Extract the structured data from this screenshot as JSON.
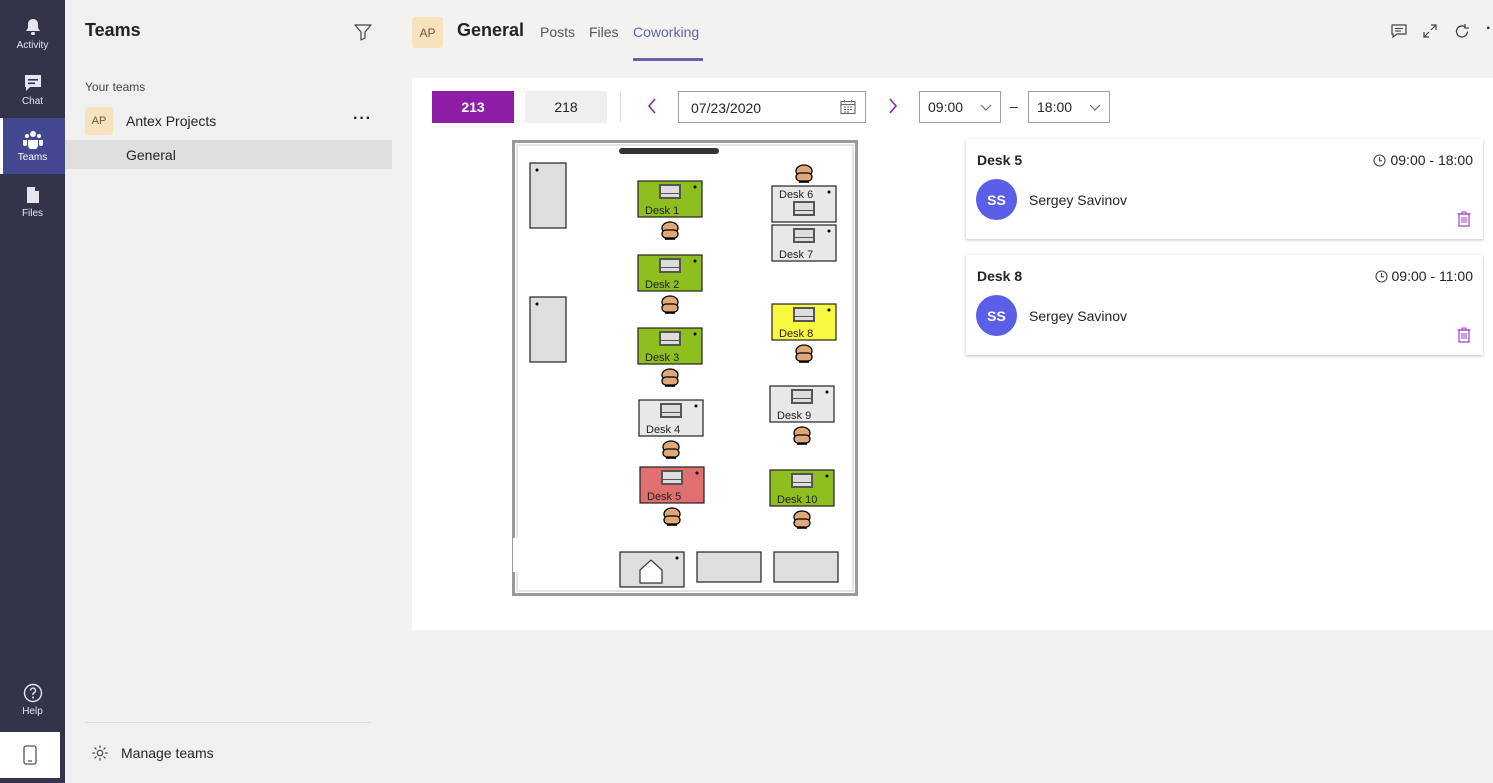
{
  "rail": {
    "items": [
      {
        "label": "Activity",
        "icon": "bell-icon"
      },
      {
        "label": "Chat",
        "icon": "chat-icon"
      },
      {
        "label": "Teams",
        "icon": "teams-icon"
      },
      {
        "label": "Files",
        "icon": "file-icon"
      }
    ],
    "help_label": "Help"
  },
  "sidebar": {
    "title": "Teams",
    "section_label": "Your teams",
    "team": {
      "avatar": "AP",
      "name": "Antex Projects"
    },
    "channel": "General",
    "manage_label": "Manage teams"
  },
  "header": {
    "avatar": "AP",
    "channel": "General",
    "tabs": [
      "Posts",
      "Files",
      "Coworking"
    ],
    "active_tab": "Coworking"
  },
  "toolbar": {
    "rooms": [
      "213",
      "218"
    ],
    "active_room": "213",
    "date": "07/23/2020",
    "time_from": "09:00",
    "time_to": "18:00",
    "dash": "–"
  },
  "floor": {
    "desks": [
      {
        "label": "Desk 1",
        "status": "available"
      },
      {
        "label": "Desk 2",
        "status": "available"
      },
      {
        "label": "Desk 3",
        "status": "available"
      },
      {
        "label": "Desk 4",
        "status": "free"
      },
      {
        "label": "Desk 5",
        "status": "booked"
      },
      {
        "label": "Desk 6",
        "status": "free"
      },
      {
        "label": "Desk 7",
        "status": "free"
      },
      {
        "label": "Desk 8",
        "status": "partial"
      },
      {
        "label": "Desk 9",
        "status": "free"
      },
      {
        "label": "Desk 10",
        "status": "available"
      }
    ],
    "colors": {
      "available": "#8fbf1f",
      "booked": "#e07070",
      "partial": "#f8f840",
      "free": "#e8e8e8"
    }
  },
  "bookings": [
    {
      "desk": "Desk 5",
      "time": "09:00 - 18:00",
      "initials": "SS",
      "user": "Sergey Savinov"
    },
    {
      "desk": "Desk 8",
      "time": "09:00 - 11:00",
      "initials": "SS",
      "user": "Sergey Savinov"
    }
  ],
  "colors": {
    "rail": "#33344a",
    "accent": "#6264a7",
    "room_active": "#8e1ea5",
    "avatar": "#5b5fe8"
  }
}
